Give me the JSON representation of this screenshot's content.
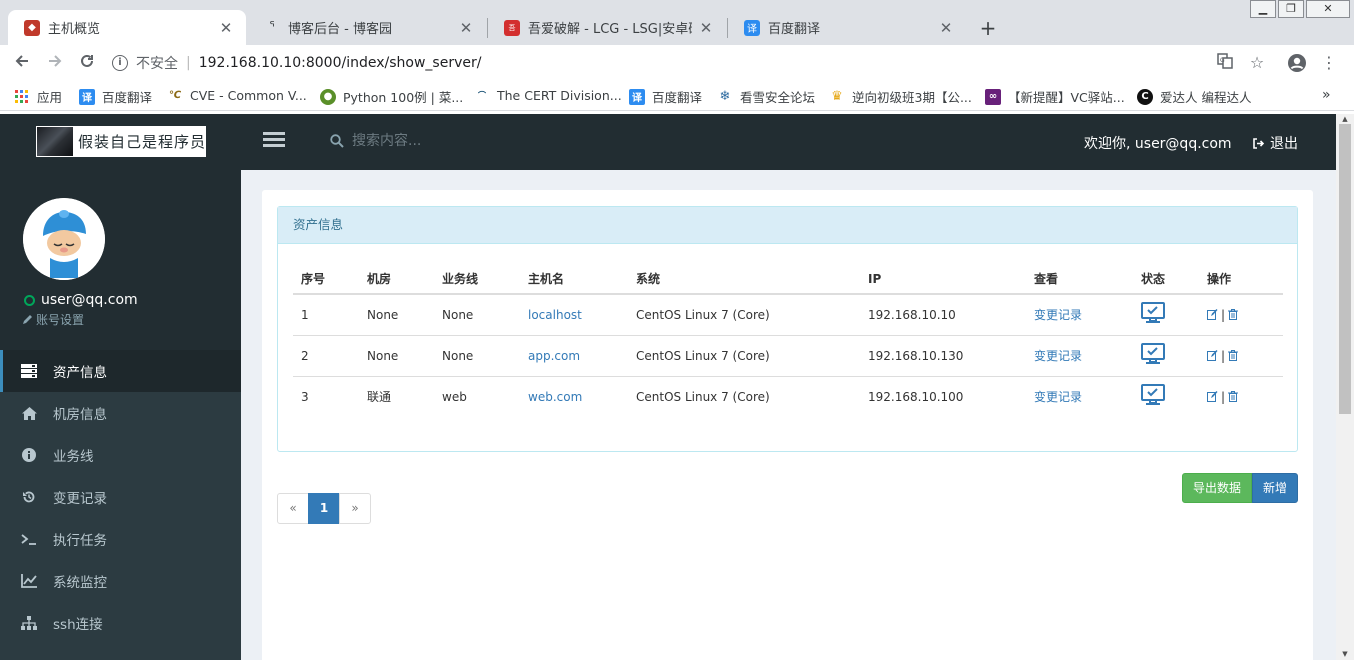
{
  "browser": {
    "tabs": [
      {
        "title": "主机概览",
        "active": true
      },
      {
        "title": "博客后台 - 博客园",
        "active": false
      },
      {
        "title": "吾爱破解 - LCG - LSG|安卓破解|",
        "active": false
      },
      {
        "title": "百度翻译",
        "active": false
      }
    ],
    "insecure_label": "不安全",
    "url": "192.168.10.10:8000/index/show_server/",
    "bookmarks": [
      {
        "label": "应用",
        "icon": "apps-grid-icon"
      },
      {
        "label": "百度翻译",
        "icon": "translate-icon"
      },
      {
        "label": "CVE - Common V...",
        "icon": "cve-icon"
      },
      {
        "label": "Python 100例 | 菜...",
        "icon": "runoob-icon"
      },
      {
        "label": "The CERT Division...",
        "icon": "cert-icon"
      },
      {
        "label": "百度翻译",
        "icon": "translate-icon"
      },
      {
        "label": "看雪安全论坛",
        "icon": "snowflake-icon"
      },
      {
        "label": "逆向初级班3期【公...",
        "icon": "trophy-icon"
      },
      {
        "label": "【新提醒】VC驿站...",
        "icon": "vs-icon"
      },
      {
        "label": "爱达人 编程达人",
        "icon": "aidaren-icon"
      }
    ]
  },
  "header": {
    "logo_text": "假装自己是程序员",
    "search_placeholder": "搜索内容...",
    "welcome": "欢迎你, user@qq.com",
    "logout": "退出"
  },
  "sidebar": {
    "user_email": "user@qq.com",
    "account_settings": "账号设置",
    "items": [
      {
        "label": "资产信息",
        "icon": "server-icon",
        "active": true
      },
      {
        "label": "机房信息",
        "icon": "home-icon",
        "active": false
      },
      {
        "label": "业务线",
        "icon": "info-icon",
        "active": false
      },
      {
        "label": "变更记录",
        "icon": "history-icon",
        "active": false
      },
      {
        "label": "执行任务",
        "icon": "terminal-icon",
        "active": false
      },
      {
        "label": "系统监控",
        "icon": "chart-icon",
        "active": false
      },
      {
        "label": "ssh连接",
        "icon": "sitemap-icon",
        "active": false
      }
    ]
  },
  "main": {
    "panel_title": "资产信息",
    "table": {
      "headers": [
        "序号",
        "机房",
        "业务线",
        "主机名",
        "系统",
        "IP",
        "查看",
        "状态",
        "操作"
      ],
      "rows": [
        {
          "id": "1",
          "room": "None",
          "business": "None",
          "hostname": "localhost",
          "os": "CentOS Linux 7 (Core)",
          "ip": "192.168.10.10",
          "view": "变更记录"
        },
        {
          "id": "2",
          "room": "None",
          "business": "None",
          "hostname": "app.com",
          "os": "CentOS Linux 7 (Core)",
          "ip": "192.168.10.130",
          "view": "变更记录"
        },
        {
          "id": "3",
          "room": "联通",
          "business": "web",
          "hostname": "web.com",
          "os": "CentOS Linux 7 (Core)",
          "ip": "192.168.10.100",
          "view": "变更记录"
        }
      ]
    },
    "export_button": "导出数据",
    "add_button": "新增",
    "pagination": {
      "prev": "«",
      "current": "1",
      "next": "»"
    }
  },
  "colors": {
    "sidebar_bg": "#2c3b41",
    "header_bg": "#222d32",
    "accent": "#3c8dbc",
    "link": "#337ab7",
    "success": "#5cb85c"
  }
}
